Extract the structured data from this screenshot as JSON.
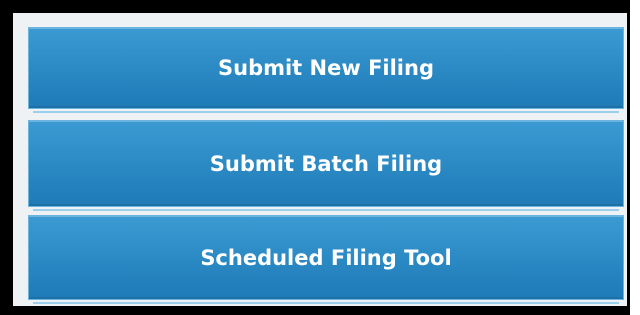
{
  "menu": {
    "items": [
      {
        "label": "Submit New Filing"
      },
      {
        "label": "Submit Batch Filing"
      },
      {
        "label": "Scheduled Filing Tool"
      }
    ]
  },
  "colors": {
    "button_top": "#3c9ad3",
    "button_bottom": "#1f7ab6",
    "button_border": "#6ab5e0",
    "text": "#ffffff",
    "frame": "#000000"
  }
}
